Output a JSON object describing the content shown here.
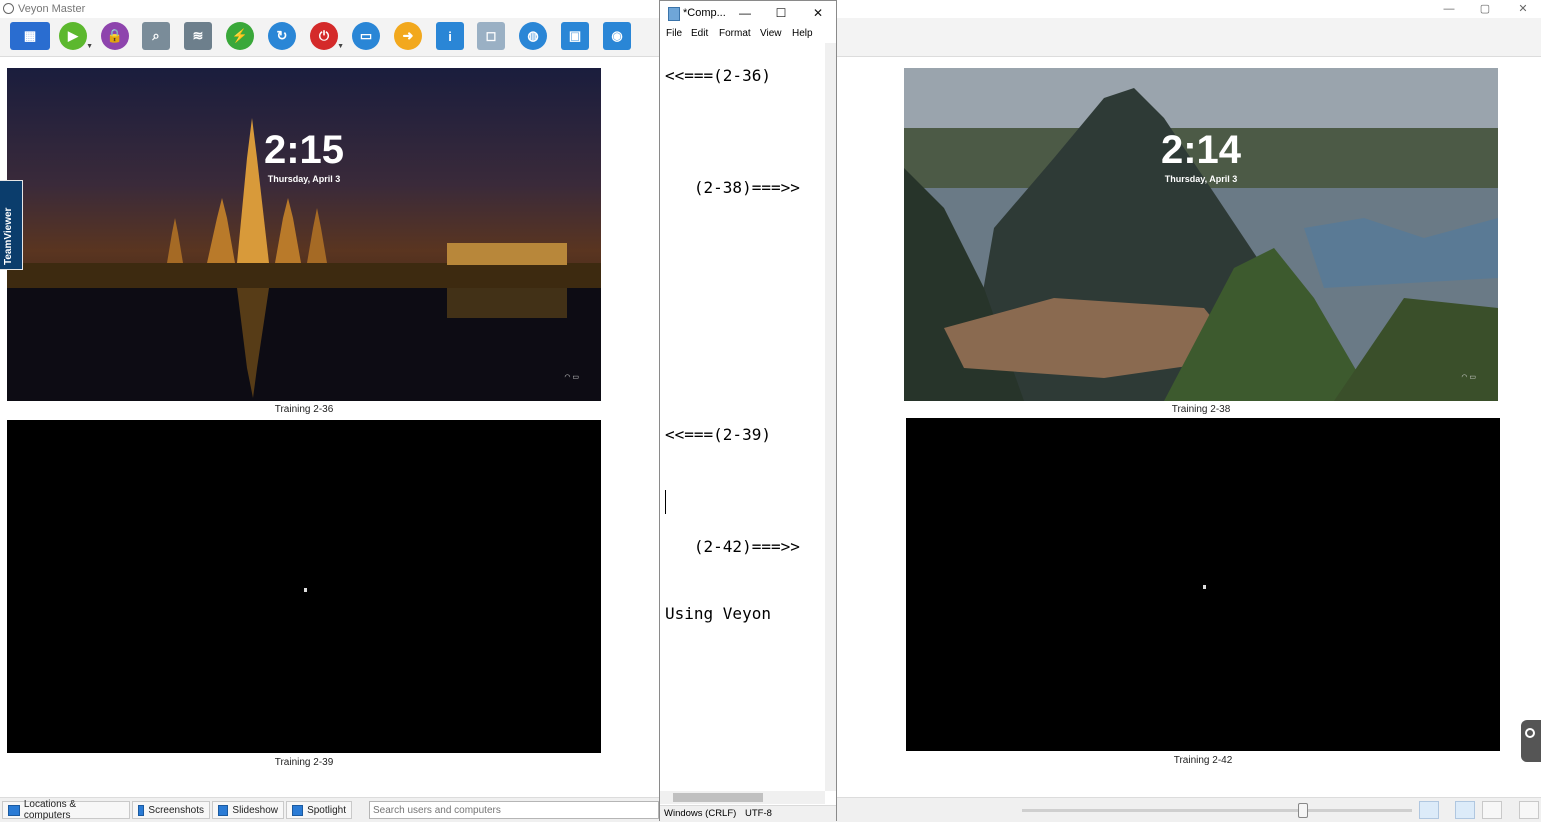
{
  "veyon": {
    "title": "Veyon Master",
    "window_buttons": [
      "—",
      "▢",
      "✕"
    ],
    "toolbar": [
      {
        "name": "monitoring-mode-button",
        "icon": "grid-icon",
        "color": "#2a6dd0",
        "shape": "sq"
      },
      {
        "name": "demo-button",
        "icon": "presentation-icon",
        "color": "#5cb82e",
        "has_menu": true
      },
      {
        "name": "lock-button",
        "icon": "lock-icon",
        "color": "#8e44ad"
      },
      {
        "name": "remote-view-button",
        "icon": "monitor-search-icon",
        "color": "#7a8c99",
        "shape": "sq"
      },
      {
        "name": "remote-control-button",
        "icon": "monitor-wifi-icon",
        "color": "#6d7f8c",
        "shape": "sq"
      },
      {
        "name": "power-on-button",
        "icon": "bolt-icon",
        "color": "#3aa83a"
      },
      {
        "name": "reboot-button",
        "icon": "refresh-icon",
        "color": "#2a86d6"
      },
      {
        "name": "power-down-button",
        "icon": "power-icon",
        "color": "#d42a2a",
        "has_menu": true
      },
      {
        "name": "login-button",
        "icon": "keyboard-icon",
        "color": "#2a86d6"
      },
      {
        "name": "logoff-button",
        "icon": "logout-icon",
        "color": "#f2a81d"
      },
      {
        "name": "message-button",
        "icon": "message-icon",
        "color": "#2a86d6",
        "shape": "sq"
      },
      {
        "name": "screen-lock-button",
        "icon": "window-icon",
        "color": "#9ab0c4",
        "shape": "sq"
      },
      {
        "name": "open-website-button",
        "icon": "globe-icon",
        "color": "#2a86d6"
      },
      {
        "name": "run-program-button",
        "icon": "app-icon",
        "color": "#2a86d6",
        "shape": "sq"
      },
      {
        "name": "screenshot-button",
        "icon": "camera-icon",
        "color": "#2a86d6",
        "shape": "sq"
      }
    ],
    "screens": [
      {
        "caption": "Training 2-36",
        "time": "2:15",
        "date": "Thursday, April 3",
        "bg": "#1c1a33"
      },
      {
        "caption": "Training 2-38",
        "time": "2:14",
        "date": "Thursday, April 3",
        "bg": "#3d5060"
      },
      {
        "caption": "Training 2-39"
      },
      {
        "caption": "Training 2-42"
      }
    ],
    "teamviewer_label": "TeamViewer",
    "statusbar": {
      "buttons": [
        "Locations & computers",
        "Screenshots",
        "Slideshow",
        "Spotlight"
      ],
      "search_placeholder": "Search users and computers"
    }
  },
  "notepad": {
    "title": "*Comp...",
    "window_buttons": [
      "—",
      "☐",
      "✕"
    ],
    "menu": [
      "File",
      "Edit",
      "Format",
      "View",
      "Help"
    ],
    "lines": [
      "<<===(2-36)",
      "   (2-38)===>>",
      "<<===(2-39)",
      "   (2-42)===>>",
      "Using Veyon"
    ],
    "status": [
      "Windows (CRLF)",
      "UTF-8"
    ]
  }
}
